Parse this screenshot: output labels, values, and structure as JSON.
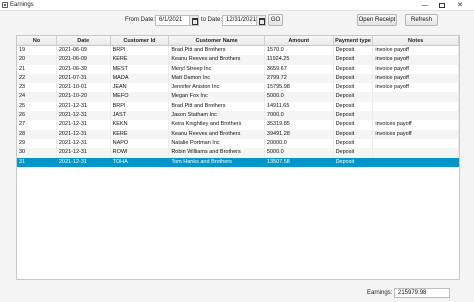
{
  "window": {
    "title": "Earnings"
  },
  "filters": {
    "from_label": "From Date:",
    "from_value": "6/1/2021",
    "to_label": "to Date:",
    "to_value": "12/31/2021",
    "go_label": "GO"
  },
  "actions": {
    "open_receipt": "Open Receipt",
    "refresh": "Refresh"
  },
  "table": {
    "columns": [
      "No",
      "Date",
      "Customer Id",
      "Customer Name",
      "Amount",
      "Payment type",
      "Notes"
    ],
    "rows": [
      [
        "19",
        "2021-06-09",
        "BRPI",
        "Brad Pitt and Brothers",
        "1570.0",
        "Deposit",
        "invoice payoff"
      ],
      [
        "20",
        "2021-06-09",
        "KERE",
        "Keanu Reeves and Brothers",
        "11924.25",
        "Deposit",
        "invoice payoff"
      ],
      [
        "21",
        "2021-06-30",
        "MEST",
        "Meryl Streep Inc",
        "3659.67",
        "Deposit",
        "invoice payoff"
      ],
      [
        "22",
        "2021-07-31",
        "MADA",
        "Matt Damon Inc",
        "2799.72",
        "Deposit",
        "invoice payoff"
      ],
      [
        "23",
        "2021-10-01",
        "JEAN",
        "Jennifer Aniston Inc",
        "15795.98",
        "Deposit",
        "invoice payoff"
      ],
      [
        "24",
        "2021-10-20",
        "MEFO",
        "Megan Fox Inc",
        "5000.0",
        "Deposit",
        ""
      ],
      [
        "25",
        "2021-12-31",
        "BRPI",
        "Brad Pitt and Brothers",
        "14911.65",
        "Deposit",
        ""
      ],
      [
        "26",
        "2021-12-31",
        "JAST",
        "Jason Statham Inc",
        "7000.0",
        "Deposit",
        ""
      ],
      [
        "27",
        "2021-12-31",
        "KEKN",
        "Keira Knightley and Brothers",
        "35319.85",
        "Deposit",
        "invoices payoff"
      ],
      [
        "28",
        "2021-12-31",
        "KERE",
        "Keanu Reeves and Brothers",
        "39491.28",
        "Deposit",
        "invoices payoff"
      ],
      [
        "29",
        "2021-12-31",
        "NAPO",
        "Natalie Portman Inc",
        "20000.0",
        "Deposit",
        ""
      ],
      [
        "30",
        "2021-12-31",
        "ROWI",
        "Robin Williams and Brothers",
        "5000.0",
        "Deposit",
        ""
      ],
      [
        "31",
        "2021-12-31",
        "TOHA",
        "Tom Hanks and Brothers",
        "13507.58",
        "Deposit",
        ""
      ]
    ],
    "selected_row": 12
  },
  "footer": {
    "earnings_label": "Earnings:",
    "earnings_value": "215979.98"
  },
  "colors": {
    "selection": "#0096c9",
    "header": "#ececec"
  }
}
